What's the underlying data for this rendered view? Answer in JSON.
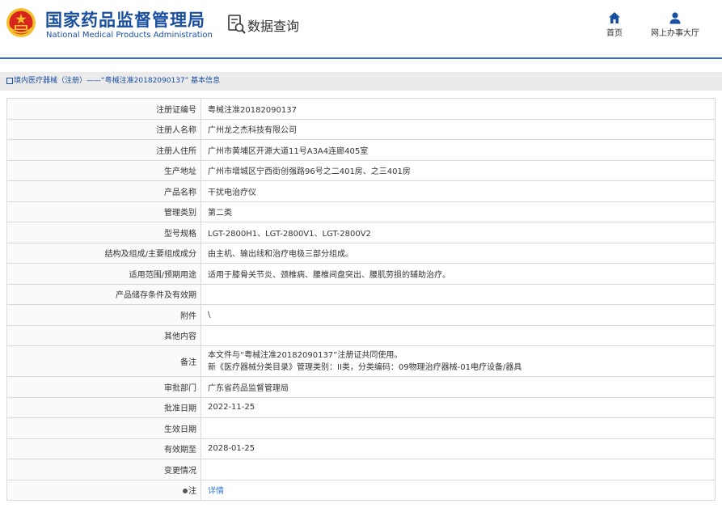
{
  "header": {
    "org_name_cn": "国家药品监督管理局",
    "org_name_en": "National Medical Products Administration",
    "section_title": "数据查询",
    "nav": [
      {
        "label": "首页",
        "icon": "home-icon"
      },
      {
        "label": "网上办事大厅",
        "icon": "user-icon"
      }
    ]
  },
  "breadcrumb": {
    "text": "境内医疗器械（注册）——“粤械注准20182090137” 基本信息"
  },
  "colors": {
    "brand_blue": "#1a4fa0",
    "divider_blue": "#2f6fc7",
    "link_blue": "#2f7bd6",
    "emblem_red": "#d8261c",
    "emblem_gold": "#f3c12e"
  },
  "record": {
    "rows": [
      {
        "label": "注册证编号",
        "value": "粤械注准20182090137"
      },
      {
        "label": "注册人名称",
        "value": "广州龙之杰科技有限公司"
      },
      {
        "label": "注册人住所",
        "value": "广州市黄埔区开源大道11号A3A4连廊405室"
      },
      {
        "label": "生产地址",
        "value": "广州市增城区宁西街创强路96号之二401房、之三401房"
      },
      {
        "label": "产品名称",
        "value": "干扰电治疗仪"
      },
      {
        "label": "管理类别",
        "value": "第二类"
      },
      {
        "label": "型号规格",
        "value": "LGT-2800H1、LGT-2800V1、LGT-2800V2"
      },
      {
        "label": "结构及组成/主要组成成分",
        "value": "由主机、输出线和治疗电极三部分组成。"
      },
      {
        "label": "适用范围/预期用途",
        "value": "适用于膝骨关节炎、颈椎病、腰椎间盘突出、腰肌劳损的辅助治疗。"
      },
      {
        "label": "产品储存条件及有效期",
        "value": ""
      },
      {
        "label": "附件",
        "value": "\\"
      },
      {
        "label": "其他内容",
        "value": ""
      }
    ],
    "remark": {
      "label": "备注",
      "line1": "本文件与“粤械注准20182090137”注册证共同使用。",
      "line2": "新《医疗器械分类目录》管理类别：II类，分类编码：09物理治疗器械-01电疗设备/器具"
    },
    "rows2": [
      {
        "label": "审批部门",
        "value": "广东省药品监督管理局"
      },
      {
        "label": "批准日期",
        "value": "2022-11-25"
      },
      {
        "label": "生效日期",
        "value": ""
      },
      {
        "label": "有效期至",
        "value": "2028-01-25"
      },
      {
        "label": "变更情况",
        "value": ""
      }
    ],
    "note": {
      "label": "注",
      "link": "详情"
    }
  }
}
